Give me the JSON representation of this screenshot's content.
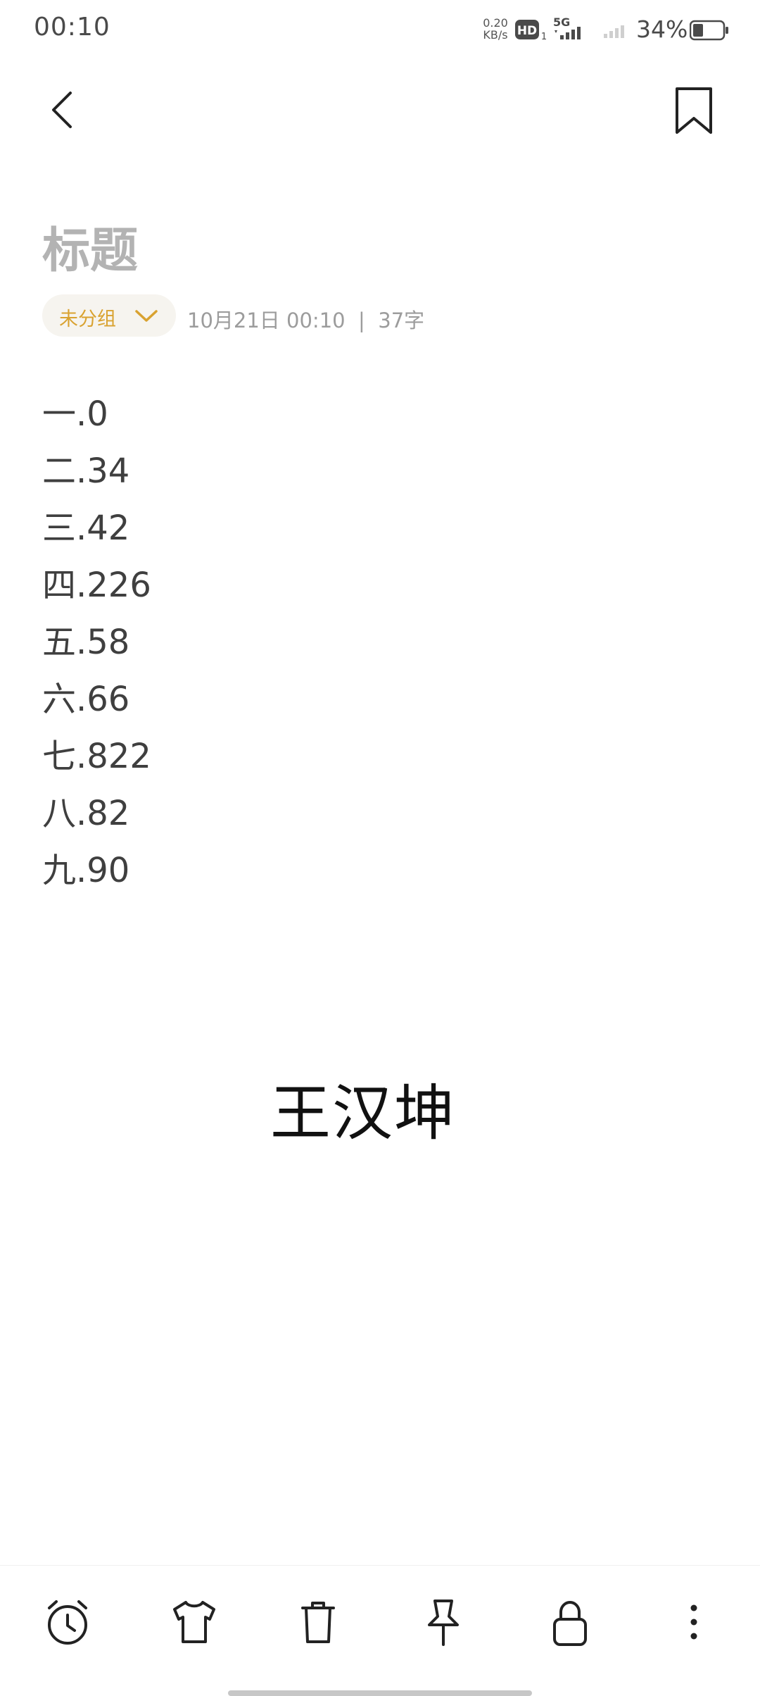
{
  "status_bar": {
    "time": "00:10",
    "net_speed_value": "0.20",
    "net_speed_unit": "KB/s",
    "hd_label": "HD",
    "hd_sub": "1",
    "network_type": "5G",
    "battery_percent": "34%",
    "battery_level": 0.34
  },
  "note": {
    "title": "标题",
    "group_label": "未分组",
    "meta": "10月21日 00:10  |  37字",
    "lines": [
      "一.0",
      "二.34",
      "三.42",
      "四.226",
      "五.58",
      "六.66",
      "七.822",
      "八.82",
      "九.90"
    ],
    "signature": "王汉坤"
  },
  "toolbar": {
    "icons": [
      "alarm-icon",
      "shirt-icon",
      "trash-icon",
      "pin-icon",
      "lock-icon",
      "more-icon"
    ]
  },
  "colors": {
    "accent": "#d9a230",
    "title_placeholder": "#b3b3b3",
    "body_text": "#3f3f3f"
  }
}
